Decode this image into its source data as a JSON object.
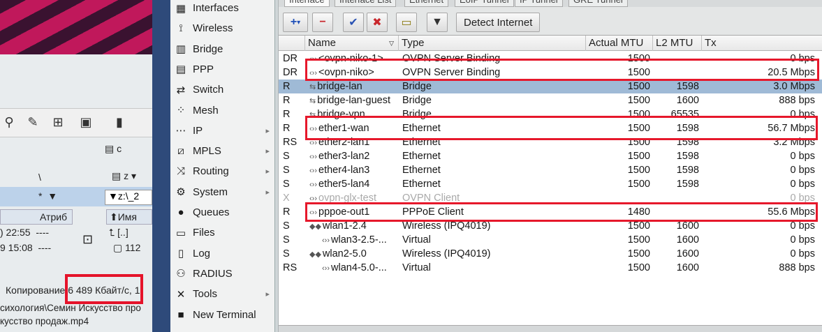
{
  "left_app": {
    "drive_labels": [
      "\\",
      "*",
      "z",
      "▼z:\\_2"
    ],
    "drive_c": "c",
    "attr_header": "Атриб",
    "name_header": "⬆Имя",
    "file_rows": [
      {
        "time": ") 22:55",
        "attr": "----",
        "name": "[..]"
      },
      {
        "time": "9 15:08",
        "attr": "----",
        "name": "112"
      }
    ],
    "status_prefix": "Копирование",
    "status_speed": "6 489 Кбайт/с,",
    "status_suffix": "1",
    "path_line1": "сихология\\Семин Искусство про",
    "path_line2": "кусство продаж.mp4"
  },
  "menu": {
    "items": [
      {
        "label": "Interfaces",
        "icon": "interfaces-icon",
        "glyph": "▦",
        "arrow": false
      },
      {
        "label": "Wireless",
        "icon": "wireless-icon",
        "glyph": "⟟",
        "arrow": false
      },
      {
        "label": "Bridge",
        "icon": "bridge-icon",
        "glyph": "▥",
        "arrow": false
      },
      {
        "label": "PPP",
        "icon": "ppp-icon",
        "glyph": "▤",
        "arrow": false
      },
      {
        "label": "Switch",
        "icon": "switch-icon",
        "glyph": "⇄",
        "arrow": false
      },
      {
        "label": "Mesh",
        "icon": "mesh-icon",
        "glyph": "⁘",
        "arrow": false
      },
      {
        "label": "IP",
        "icon": "ip-icon",
        "glyph": "⋯",
        "arrow": true
      },
      {
        "label": "MPLS",
        "icon": "mpls-icon",
        "glyph": "⧄",
        "arrow": true
      },
      {
        "label": "Routing",
        "icon": "routing-icon",
        "glyph": "⤨",
        "arrow": true
      },
      {
        "label": "System",
        "icon": "system-icon",
        "glyph": "⚙",
        "arrow": true
      },
      {
        "label": "Queues",
        "icon": "queues-icon",
        "glyph": "●",
        "arrow": false
      },
      {
        "label": "Files",
        "icon": "files-icon",
        "glyph": "▭",
        "arrow": false
      },
      {
        "label": "Log",
        "icon": "log-icon",
        "glyph": "▯",
        "arrow": false
      },
      {
        "label": "RADIUS",
        "icon": "radius-icon",
        "glyph": "⚇",
        "arrow": false
      },
      {
        "label": "Tools",
        "icon": "tools-icon",
        "glyph": "✕",
        "arrow": true
      },
      {
        "label": "New Terminal",
        "icon": "terminal-icon",
        "glyph": "■",
        "arrow": false
      }
    ]
  },
  "tabs": [
    "Interface",
    "Interface List",
    "Ethernet",
    "EoIP Tunnel",
    "IP Tunnel",
    "GRE Tunnel"
  ],
  "toolbar": {
    "add_label": "+",
    "remove_label": "−",
    "enable_label": "✔",
    "disable_label": "✖",
    "comment_label": "▭",
    "filter_label": "▼",
    "detect_label": "Detect Internet"
  },
  "columns": {
    "name": "Name",
    "type": "Type",
    "actual_mtu": "Actual MTU",
    "l2_mtu": "L2 MTU",
    "tx": "Tx"
  },
  "interfaces": [
    {
      "flags": "DR",
      "name": "<ovpn-niko-1>",
      "type": "OVPN Server Binding",
      "mtu": "1500",
      "l2mtu": "",
      "tx": "0 bps",
      "icon": "‹››",
      "indent": 0
    },
    {
      "flags": "DR",
      "name": "<ovpn-niko>",
      "type": "OVPN Server Binding",
      "mtu": "1500",
      "l2mtu": "",
      "tx": "20.5 Mbps",
      "icon": "‹››",
      "indent": 0
    },
    {
      "flags": "R",
      "name": "bridge-lan",
      "type": "Bridge",
      "mtu": "1500",
      "l2mtu": "1598",
      "tx": "3.0 Mbps",
      "icon": "⇆",
      "indent": 0
    },
    {
      "flags": "R",
      "name": "bridge-lan-guest",
      "type": "Bridge",
      "mtu": "1500",
      "l2mtu": "1600",
      "tx": "888 bps",
      "icon": "⇆",
      "indent": 0
    },
    {
      "flags": "R",
      "name": "bridge-vpn",
      "type": "Bridge",
      "mtu": "1500",
      "l2mtu": "65535",
      "tx": "0 bps",
      "icon": "⇆",
      "indent": 0
    },
    {
      "flags": "R",
      "name": "ether1-wan",
      "type": "Ethernet",
      "mtu": "1500",
      "l2mtu": "1598",
      "tx": "56.7 Mbps",
      "icon": "‹››",
      "indent": 0
    },
    {
      "flags": "RS",
      "name": "ether2-lan1",
      "type": "Ethernet",
      "mtu": "1500",
      "l2mtu": "1598",
      "tx": "3.2 Mbps",
      "icon": "‹››",
      "indent": 0
    },
    {
      "flags": "S",
      "name": "ether3-lan2",
      "type": "Ethernet",
      "mtu": "1500",
      "l2mtu": "1598",
      "tx": "0 bps",
      "icon": "‹››",
      "indent": 0
    },
    {
      "flags": "S",
      "name": "ether4-lan3",
      "type": "Ethernet",
      "mtu": "1500",
      "l2mtu": "1598",
      "tx": "0 bps",
      "icon": "‹››",
      "indent": 0
    },
    {
      "flags": "S",
      "name": "ether5-lan4",
      "type": "Ethernet",
      "mtu": "1500",
      "l2mtu": "1598",
      "tx": "0 bps",
      "icon": "‹››",
      "indent": 0
    },
    {
      "flags": "X",
      "name": "ovpn-glx-test",
      "type": "OVPN Client",
      "mtu": "",
      "l2mtu": "",
      "tx": "0 bps",
      "icon": "‹››",
      "indent": 0,
      "disabled": true
    },
    {
      "flags": "R",
      "name": "pppoe-out1",
      "type": "PPPoE Client",
      "mtu": "1480",
      "l2mtu": "",
      "tx": "55.6 Mbps",
      "icon": "‹››",
      "indent": 0
    },
    {
      "flags": "S",
      "name": "wlan1-2.4",
      "type": "Wireless (IPQ4019)",
      "mtu": "1500",
      "l2mtu": "1600",
      "tx": "0 bps",
      "icon": "◆◆",
      "indent": 0
    },
    {
      "flags": "S",
      "name": "wlan3-2.5-...",
      "type": "Virtual",
      "mtu": "1500",
      "l2mtu": "1600",
      "tx": "0 bps",
      "icon": "‹››",
      "indent": 1
    },
    {
      "flags": "S",
      "name": "wlan2-5.0",
      "type": "Wireless (IPQ4019)",
      "mtu": "1500",
      "l2mtu": "1600",
      "tx": "0 bps",
      "icon": "◆◆",
      "indent": 0
    },
    {
      "flags": "RS",
      "name": "wlan4-5.0-...",
      "type": "Virtual",
      "mtu": "1500",
      "l2mtu": "1600",
      "tx": "888 bps",
      "icon": "‹››",
      "indent": 1
    }
  ],
  "selected_row": 2,
  "highlight_color": "#e6182b",
  "selection_color": "#9fbad6"
}
